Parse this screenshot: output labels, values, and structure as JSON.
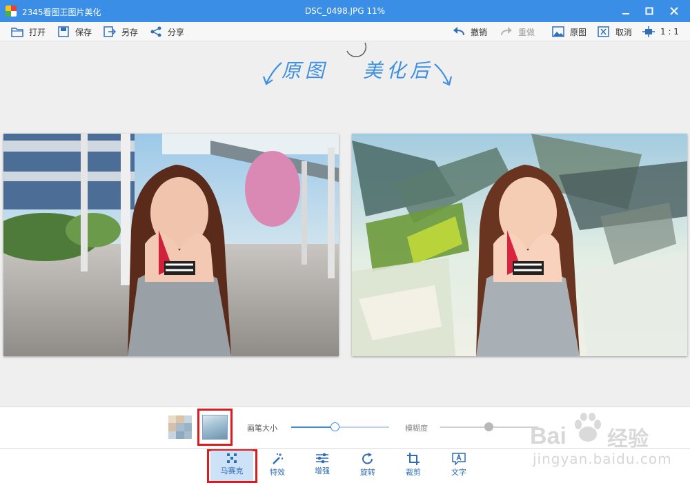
{
  "titlebar": {
    "app_title": "2345看图王图片美化",
    "file_title": "DSC_0498.JPG  11%"
  },
  "toolbar": {
    "open": "打开",
    "save": "保存",
    "save_as": "另存",
    "share": "分享",
    "undo": "撤销",
    "redo": "重做",
    "original": "原图",
    "cancel": "取消",
    "ratio": "1 : 1"
  },
  "canvas": {
    "label_before": "原图",
    "label_after": "美化后"
  },
  "options": {
    "brush_size_label": "画笔大小",
    "blur_label": "模糊度",
    "brush_size": 0.45,
    "blur": 0.5
  },
  "tools": [
    {
      "label": "马赛克",
      "icon": "mosaic-icon"
    },
    {
      "label": "特效",
      "icon": "magic-wand-icon"
    },
    {
      "label": "增强",
      "icon": "sliders-icon"
    },
    {
      "label": "旋转",
      "icon": "rotate-icon"
    },
    {
      "label": "裁剪",
      "icon": "crop-icon"
    },
    {
      "label": "文字",
      "icon": "text-icon"
    }
  ],
  "watermark": {
    "brand": "Bai",
    "brand_cn": "经验",
    "url": "jingyan.baidu.com"
  },
  "colors": {
    "accent": "#3a8ee6",
    "highlight": "#e0191c",
    "active_tool_bg": "#cde2f7"
  }
}
